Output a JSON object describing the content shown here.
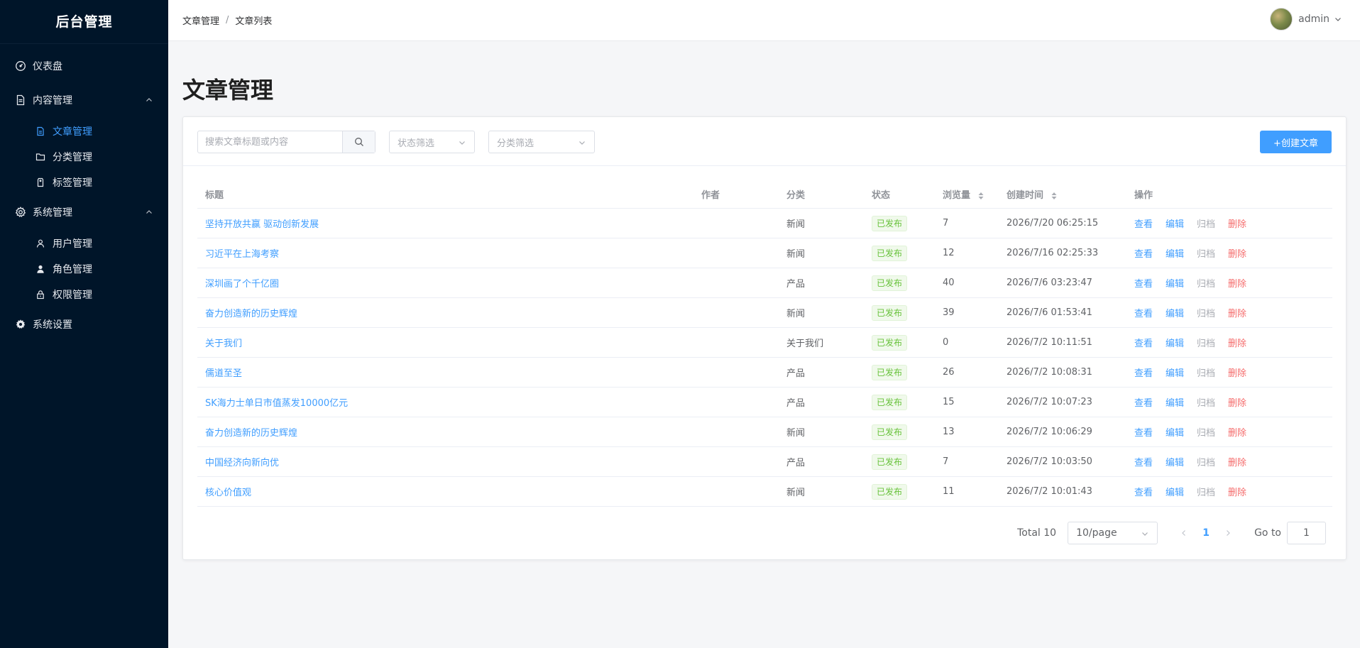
{
  "brand": "后台管理",
  "sidebar": {
    "dashboard": "仪表盘",
    "content": {
      "label": "内容管理",
      "items": [
        "文章管理",
        "分类管理",
        "标签管理"
      ]
    },
    "system": {
      "label": "系统管理",
      "items": [
        "用户管理",
        "角色管理",
        "权限管理"
      ]
    },
    "settings": "系统设置",
    "active_item": "文章管理"
  },
  "header": {
    "breadcrumb": [
      "文章管理",
      "文章列表"
    ],
    "separator": "/",
    "username": "admin"
  },
  "main": {
    "title": "文章管理",
    "search_placeholder": "搜索文章标题或内容",
    "status_filter_placeholder": "状态筛选",
    "category_filter_placeholder": "分类筛选",
    "create_button": "+创建文章"
  },
  "table": {
    "columns": [
      "标题",
      "作者",
      "分类",
      "状态",
      "浏览量",
      "创建时间",
      "操作"
    ],
    "actions": {
      "view": "查看",
      "edit": "编辑",
      "archive": "归档",
      "delete": "删除"
    },
    "rows": [
      {
        "title": "坚持开放共赢 驱动创新发展",
        "author": "",
        "category": "新闻",
        "status": "已发布",
        "views": "7",
        "created": "2026/7/20 06:25:15"
      },
      {
        "title": "习近平在上海考察",
        "author": "",
        "category": "新闻",
        "status": "已发布",
        "views": "12",
        "created": "2026/7/16 02:25:33"
      },
      {
        "title": "深圳画了个千亿圈",
        "author": "",
        "category": "产品",
        "status": "已发布",
        "views": "40",
        "created": "2026/7/6 03:23:47"
      },
      {
        "title": "奋力创造新的历史辉煌",
        "author": "",
        "category": "新闻",
        "status": "已发布",
        "views": "39",
        "created": "2026/7/6 01:53:41"
      },
      {
        "title": "关于我们",
        "author": "",
        "category": "关于我们",
        "status": "已发布",
        "views": "0",
        "created": "2026/7/2 10:11:51"
      },
      {
        "title": "儒道至圣",
        "author": "",
        "category": "产品",
        "status": "已发布",
        "views": "26",
        "created": "2026/7/2 10:08:31"
      },
      {
        "title": "SK海力士单日市值蒸发10000亿元",
        "author": "",
        "category": "产品",
        "status": "已发布",
        "views": "15",
        "created": "2026/7/2 10:07:23"
      },
      {
        "title": "奋力创造新的历史辉煌",
        "author": "",
        "category": "新闻",
        "status": "已发布",
        "views": "13",
        "created": "2026/7/2 10:06:29"
      },
      {
        "title": "中国经济向新向优",
        "author": "",
        "category": "产品",
        "status": "已发布",
        "views": "7",
        "created": "2026/7/2 10:03:50"
      },
      {
        "title": "核心价值观",
        "author": "",
        "category": "新闻",
        "status": "已发布",
        "views": "11",
        "created": "2026/7/2 10:01:43"
      }
    ]
  },
  "pagination": {
    "total_label": "Total 10",
    "page_size": "10/page",
    "current_page": "1",
    "goto_label": "Go to",
    "goto_value": "1"
  },
  "colors": {
    "sidebar_bg": "#001529",
    "accent": "#409eff",
    "success": "#67c23a",
    "danger": "#f56c6c"
  },
  "icons": {
    "dashboard": "dashboard-gauge-icon",
    "content": "document-icon",
    "article": "document-icon",
    "category": "folder-icon",
    "tag": "tag-icon",
    "system": "gear-icon",
    "user": "user-icon",
    "role": "user-filled-icon",
    "permission": "lock-icon",
    "settings": "gear-filled-icon",
    "search": "search-icon"
  }
}
